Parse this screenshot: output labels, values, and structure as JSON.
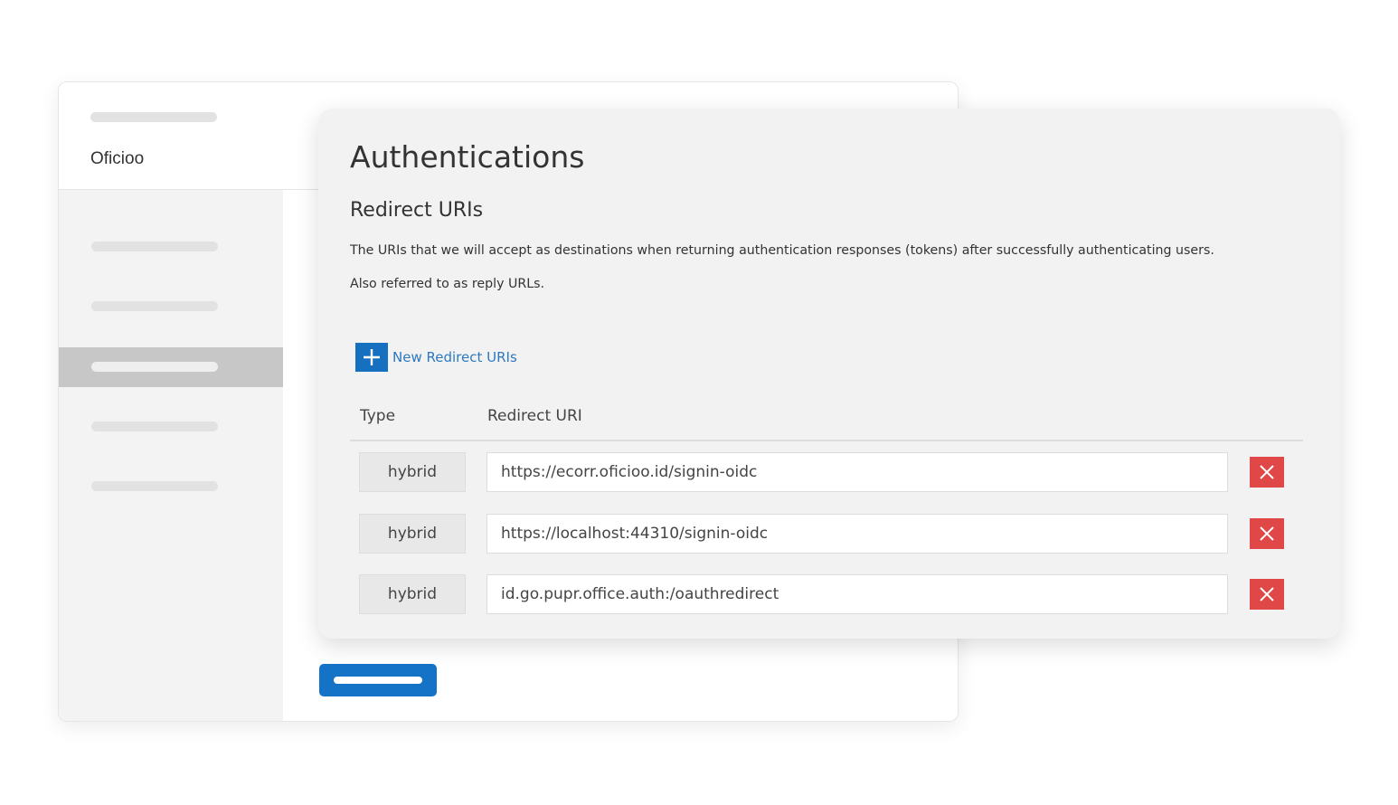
{
  "app": {
    "name": "Oficioo"
  },
  "panel": {
    "title": "Authentications",
    "section_title": "Redirect URIs",
    "description_line1": "The URIs that we will accept as destinations when returning authentication responses (tokens) after successfully authenticating users.",
    "description_line2": "Also referred to as reply URLs.",
    "add_label": "New Redirect URIs",
    "columns": {
      "type": "Type",
      "uri": "Redirect URI"
    },
    "rows": [
      {
        "type": "hybrid",
        "uri": "https://ecorr.oficioo.id/signin-oidc"
      },
      {
        "type": "hybrid",
        "uri": "https://localhost:44310/signin-oidc"
      },
      {
        "type": "hybrid",
        "uri": "id.go.pupr.office.auth:/oauthredirect"
      }
    ]
  },
  "icons": {
    "add": "plus-icon",
    "delete": "close-icon"
  },
  "colors": {
    "accent": "#1670c0",
    "link": "#2d79c0",
    "danger": "#e04848",
    "selected_nav": "#c7c7c7"
  }
}
